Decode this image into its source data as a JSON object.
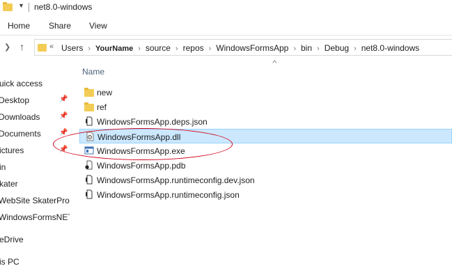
{
  "window": {
    "title": "net8.0-windows"
  },
  "ribbon": {
    "tabs": [
      "Home",
      "Share",
      "View"
    ]
  },
  "address": {
    "overflow": "«",
    "crumbs": [
      "Users",
      "YourName",
      "source",
      "repos",
      "WindowsFormsApp",
      "bin",
      "Debug",
      "net8.0-windows"
    ]
  },
  "columns": {
    "name": "Name"
  },
  "nav": {
    "items": [
      {
        "label": "uick access",
        "pinned": false
      },
      {
        "label": "Desktop",
        "pinned": true
      },
      {
        "label": "Downloads",
        "pinned": true
      },
      {
        "label": "Documents",
        "pinned": true
      },
      {
        "label": "ictures",
        "pinned": true
      },
      {
        "label": "in",
        "pinned": false
      },
      {
        "label": "kater",
        "pinned": false
      },
      {
        "label": "WebSite SkaterPro",
        "pinned": false
      },
      {
        "label": "WindowsFormsNET",
        "pinned": false
      },
      {
        "label": "eDrive",
        "pinned": false
      },
      {
        "label": "is PC",
        "pinned": false
      }
    ]
  },
  "files": [
    {
      "name": "new",
      "icon": "folder-icon"
    },
    {
      "name": "ref",
      "icon": "folder-icon"
    },
    {
      "name": "WindowsFormsApp.deps.json",
      "icon": "json-file-icon"
    },
    {
      "name": "WindowsFormsApp.dll",
      "icon": "dll-file-icon",
      "selected": true
    },
    {
      "name": "WindowsFormsApp.exe",
      "icon": "exe-file-icon"
    },
    {
      "name": "WindowsFormsApp.pdb",
      "icon": "pdb-file-icon"
    },
    {
      "name": "WindowsFormsApp.runtimeconfig.dev.json",
      "icon": "json-file-icon"
    },
    {
      "name": "WindowsFormsApp.runtimeconfig.json",
      "icon": "json-file-icon"
    }
  ],
  "colors": {
    "selection": "#cce8ff",
    "selection_border": "#99d1ff",
    "callout": "#d0021b",
    "folder": "#f3cc55"
  }
}
